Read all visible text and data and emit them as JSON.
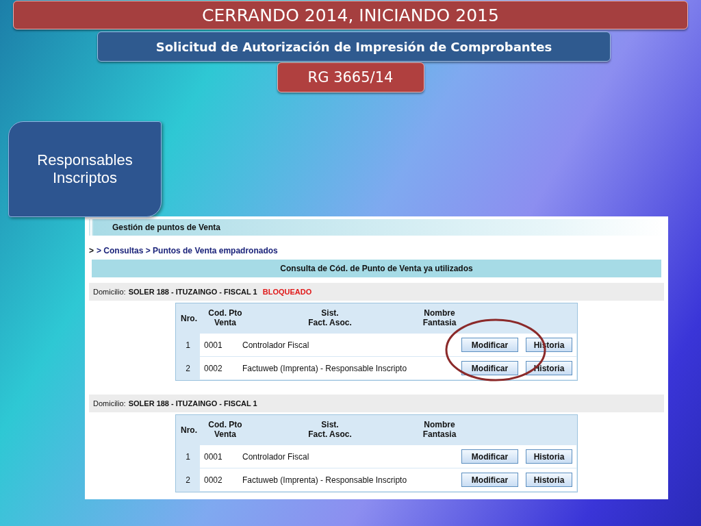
{
  "slide": {
    "title": "CERRANDO 2014, INICIANDO 2015",
    "subtitle": "Solicitud de Autorización de Impresión de Comprobantes",
    "reference": "RG 3665/14",
    "side_label": "Responsables Inscriptos"
  },
  "app": {
    "header": "Gestión de puntos de Venta",
    "breadcrumb_home": ">",
    "breadcrumb": "> Consultas > Puntos de Venta empadronados",
    "section_title": "Consulta de Cód. de Punto de Venta ya utilizados",
    "domicilios": [
      {
        "label": "Domicilio:",
        "address": "SOLER 188 - ITUZAINGO - FISCAL 1",
        "status": "BLOQUEADO",
        "circled": true,
        "columns": [
          "Nro.",
          "Cod. Pto\nVenta",
          "Sist.\nFact. Asoc.",
          "Nombre\nFantasia"
        ],
        "rows": [
          {
            "nro": "1",
            "cod": "0001",
            "sist": "Controlador Fiscal",
            "buttons": [
              "Modificar",
              "Historia"
            ]
          },
          {
            "nro": "2",
            "cod": "0002",
            "sist": "Factuweb (Imprenta) - Responsable Inscripto",
            "buttons": [
              "Modificar",
              "Historia"
            ]
          }
        ]
      },
      {
        "label": "Domicilio:",
        "address": "SOLER 188 - ITUZAINGO - FISCAL 1",
        "circled": false,
        "columns": [
          "Nro.",
          "Cod. Pto\nVenta",
          "Sist.\nFact. Asoc.",
          "Nombre\nFantasia"
        ],
        "rows": [
          {
            "nro": "1",
            "cod": "0001",
            "sist": "Controlador Fiscal",
            "buttons": [
              "Modificar",
              "Historia"
            ]
          },
          {
            "nro": "2",
            "cod": "0002",
            "sist": "Factuweb (Imprenta) - Responsable Inscripto",
            "buttons": [
              "Modificar",
              "Historia"
            ]
          }
        ]
      }
    ]
  }
}
